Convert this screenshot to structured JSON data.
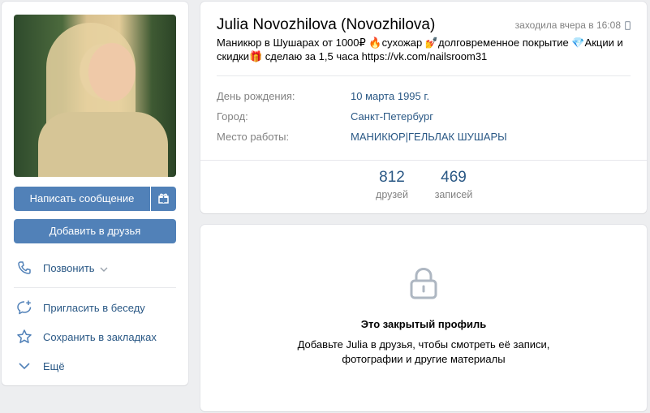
{
  "profile": {
    "name": "Julia Novozhilova (Novozhilova)",
    "online": "заходила вчера в 16:08",
    "status": "Маникюр в Шушарах от 1000₽ 🔥сухожар 💅долговременное покрытие 💎Акции и скидки🎁 сделаю за 1,5 часа https://vk.com/nailsroom31",
    "fields": [
      {
        "label": "День рождения:",
        "value": "10 марта 1995 г."
      },
      {
        "label": "Город:",
        "value": "Санкт-Петербург"
      },
      {
        "label": "Место работы:",
        "value": "МАНИКЮР|ГЕЛЬЛАК ШУШАРЫ"
      }
    ],
    "counters": [
      {
        "count": "812",
        "label": "друзей"
      },
      {
        "count": "469",
        "label": "записей"
      }
    ]
  },
  "actions": {
    "message": "Написать сообщение",
    "add_friend": "Добавить в друзья",
    "call": "Позвонить",
    "invite": "Пригласить в беседу",
    "bookmark": "Сохранить в закладках",
    "more": "Ещё"
  },
  "closed": {
    "title": "Это закрытый профиль",
    "text": "Добавьте Julia в друзья, чтобы смотреть её записи, фотографии и другие материалы"
  },
  "colors": {
    "accent": "#5181b8",
    "link": "#2a5885",
    "muted": "#828282",
    "background": "#edeef0"
  },
  "icons": [
    "gift-icon",
    "phone-icon",
    "chevron-down-icon",
    "chat-add-icon",
    "star-icon",
    "lock-icon",
    "mobile-icon"
  ]
}
